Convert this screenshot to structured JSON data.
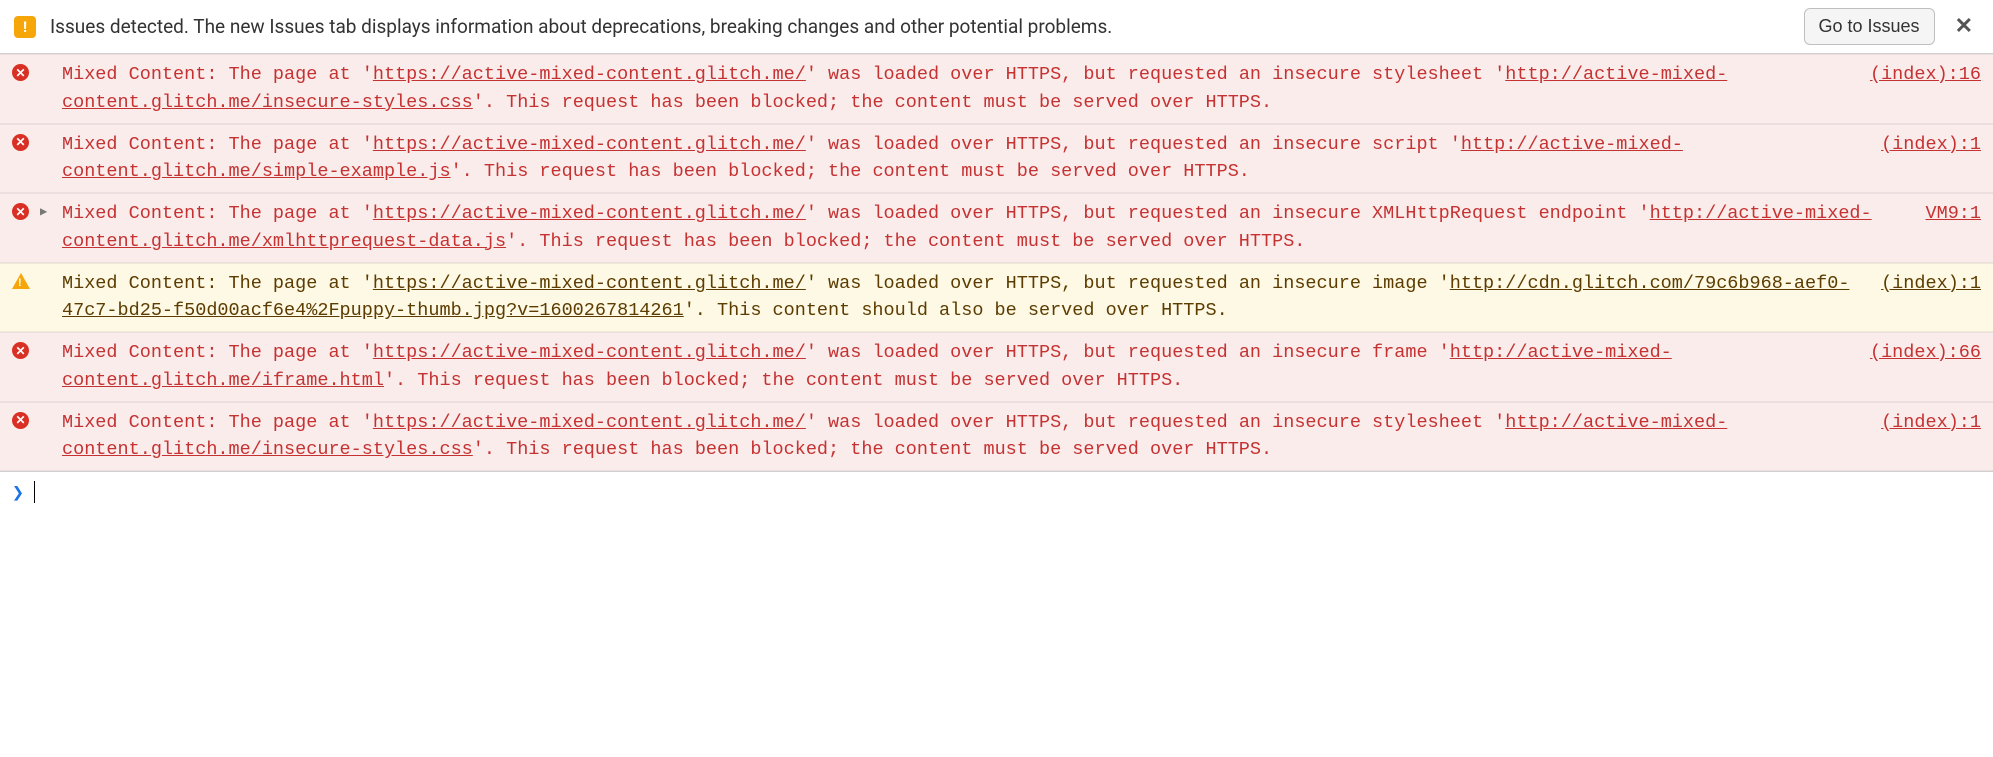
{
  "issues_bar": {
    "text": "Issues detected. The new Issues tab displays information about deprecations, breaking changes and other potential problems.",
    "button_label": "Go to Issues",
    "close_label": "✕"
  },
  "logs": [
    {
      "level": "error",
      "expandable": false,
      "prefix": "Mixed Content: The page at '",
      "page_url": "https://active-mixed-content.glitch.me/",
      "mid1": "' was loaded over HTTPS, but requested an insecure stylesheet '",
      "resource_url": "http://active-mixed-content.glitch.me/insecure-styles.css",
      "suffix": "'. This request has been blocked; the content must be served over HTTPS.",
      "source": "(index):16"
    },
    {
      "level": "error",
      "expandable": false,
      "prefix": "Mixed Content: The page at '",
      "page_url": "https://active-mixed-content.glitch.me/",
      "mid1": "' was loaded over HTTPS, but requested an insecure script '",
      "resource_url": "http://active-mixed-content.glitch.me/simple-example.js",
      "suffix": "'. This request has been blocked; the content must be served over HTTPS.",
      "source": "(index):1"
    },
    {
      "level": "error",
      "expandable": true,
      "prefix": "Mixed Content: The page at '",
      "page_url": "https://active-mixed-content.glitch.me/",
      "mid1": "' was loaded over HTTPS, but requested an insecure XMLHttpRequest endpoint '",
      "resource_url": "http://active-mixed-content.glitch.me/xmlhttprequest-data.js",
      "suffix": "'. This request has been blocked; the content must be served over HTTPS.",
      "source": "VM9:1"
    },
    {
      "level": "warning",
      "expandable": false,
      "prefix": "Mixed Content: The page at '",
      "page_url": "https://active-mixed-content.glitch.me/",
      "mid1": "' was loaded over HTTPS, but requested an insecure image '",
      "resource_url": "http://cdn.glitch.com/79c6b968-aef0-47c7-bd25-f50d00acf6e4%2Fpuppy-thumb.jpg?v=1600267814261",
      "suffix": "'. This content should also be served over HTTPS.",
      "source": "(index):1"
    },
    {
      "level": "error",
      "expandable": false,
      "prefix": "Mixed Content: The page at '",
      "page_url": "https://active-mixed-content.glitch.me/",
      "mid1": "' was loaded over HTTPS, but requested an insecure frame '",
      "resource_url": "http://active-mixed-content.glitch.me/iframe.html",
      "suffix": "'. This request has been blocked; the content must be served over HTTPS.",
      "source": "(index):66"
    },
    {
      "level": "error",
      "expandable": false,
      "prefix": "Mixed Content: The page at '",
      "page_url": "https://active-mixed-content.glitch.me/",
      "mid1": "' was loaded over HTTPS, but requested an insecure stylesheet '",
      "resource_url": "http://active-mixed-content.glitch.me/insecure-styles.css",
      "suffix": "'. This request has been blocked; the content must be served over HTTPS.",
      "source": "(index):1"
    }
  ],
  "prompt": {
    "caret": "❯",
    "value": ""
  }
}
